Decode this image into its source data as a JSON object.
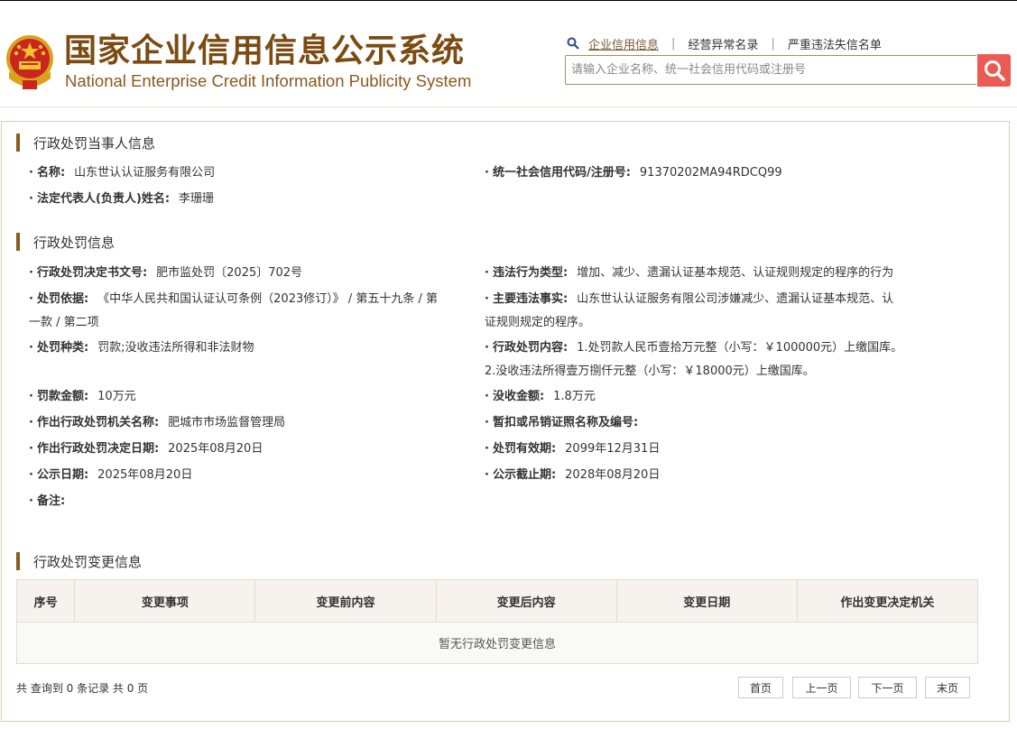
{
  "header": {
    "title_cn": "国家企业信用信息公示系统",
    "title_en": "National Enterprise Credit Information Publicity System",
    "nav": [
      "企业信用信息",
      "经营异常名录",
      "严重违法失信名单"
    ],
    "search_placeholder": "请输入企业名称、统一社会信用代码或注册号"
  },
  "party": {
    "title": "行政处罚当事人信息",
    "name_label": "名称:",
    "name": "山东世认认证服务有限公司",
    "credit_code_label": "统一社会信用代码/注册号:",
    "credit_code": "91370202MA94RDCQ99",
    "legal_rep_label": "法定代表人(负责人)姓名:",
    "legal_rep": "李珊珊"
  },
  "penalty": {
    "title": "行政处罚信息",
    "decision_no_label": "行政处罚决定书文号:",
    "decision_no": "肥市监处罚〔2025〕702号",
    "violation_type_label": "违法行为类型:",
    "violation_type": "增加、减少、遗漏认证基本规范、认证规则规定的程序的行为",
    "basis_label": "处罚依据:",
    "basis_line1": "《中华人民共和国认证认可条例（2023修订）》 / 第五十九条 / 第",
    "basis_line2": "一款 / 第二项",
    "main_facts_label": "主要违法事实:",
    "main_facts_line1": "山东世认认证服务有限公司涉嫌减少、遗漏认证基本规范、认",
    "main_facts_line2": "证规则规定的程序。",
    "category_label": "处罚种类:",
    "category": "罚款;没收违法所得和非法财物",
    "content_label": "行政处罚内容:",
    "content_line1": "1.处罚款人民币壹拾万元整（小写：￥100000元）上缴国库。",
    "content_line2": "2.没收违法所得壹万捌仟元整（小写：￥18000元）上缴国库。",
    "fine_label": "罚款金额:",
    "fine": "10万元",
    "confiscation_label": "没收金额:",
    "confiscation": "1.8万元",
    "authority_label": "作出行政处罚机关名称:",
    "authority": "肥城市市场监督管理局",
    "license_label": "暂扣或吊销证照名称及编号:",
    "license": "",
    "decision_date_label": "作出行政处罚决定日期:",
    "decision_date": "2025年08月20日",
    "valid_until_label": "处罚有效期:",
    "valid_until": "2099年12月31日",
    "publish_date_label": "公示日期:",
    "publish_date": "2025年08月20日",
    "publish_end_label": "公示截止期:",
    "publish_end": "2028年08月20日",
    "remark_label": "备注:",
    "remark": ""
  },
  "changes": {
    "title": "行政处罚变更信息",
    "columns": [
      "序号",
      "变更事项",
      "变更前内容",
      "变更后内容",
      "变更日期",
      "作出变更决定机关"
    ],
    "empty_text": "暂无行政处罚变更信息",
    "summary": "共 查询到 0 条记录 共 0 页",
    "pager": [
      "首页",
      "上一页",
      "下一页",
      "末页"
    ]
  }
}
